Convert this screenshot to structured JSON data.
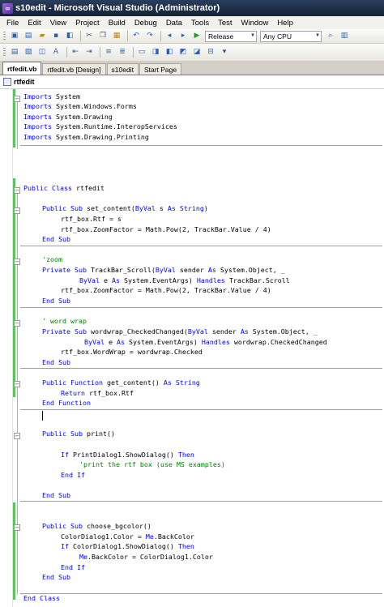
{
  "window": {
    "title": "s10edit - Microsoft Visual Studio (Administrator)"
  },
  "menu": [
    "File",
    "Edit",
    "View",
    "Project",
    "Build",
    "Debug",
    "Data",
    "Tools",
    "Test",
    "Window",
    "Help"
  ],
  "toolbar": {
    "configuration": "Release",
    "platform": "Any CPU"
  },
  "tabs": [
    "rtfedit.vb",
    "rtfedit.vb [Design]",
    "s10edit",
    "Start Page"
  ],
  "editor": {
    "class_selector": "rtfedit",
    "code_lines": [
      "Imports System",
      "Imports System.Windows.Forms",
      "Imports System.Drawing",
      "Imports System.Runtime.InteropServices",
      "Imports System.Drawing.Printing",
      "Public Class rtfedit",
      "Public Sub set_content(ByVal s As String)",
      "rtf_box.Rtf = s",
      "rtf_box.ZoomFactor = Math.Pow(2, TrackBar.Value / 4)",
      "End Sub",
      "'zoom",
      "Private Sub TrackBar_Scroll(ByVal sender As System.Object, _",
      "ByVal e As System.EventArgs) Handles TrackBar.Scroll",
      "rtf_box.ZoomFactor = Math.Pow(2, TrackBar.Value / 4)",
      "End Sub",
      "' word wrap",
      "Private Sub wordwrap_CheckedChanged(ByVal sender As System.Object, _",
      "ByVal e As System.EventArgs) Handles wordwrap.CheckedChanged",
      "rtf_box.WordWrap = wordwrap.Checked",
      "End Sub",
      "Public Function get_content() As String",
      "Return rtf_box.Rtf",
      "End Function",
      "Public Sub print()",
      "If PrintDialog1.ShowDialog() Then",
      "'print the rtf box (use MS examples)",
      "End If",
      "End Sub",
      "Public Sub choose_bgcolor()",
      "ColorDialog1.Color = Me.BackColor",
      "If ColorDialog1.ShowDialog() Then",
      "Me.BackColor = ColorDialog1.Color",
      "End If",
      "End Sub",
      "End Class"
    ]
  },
  "colors": {
    "keyword": "#0000ff",
    "comment": "#008000",
    "type": "#2b91af",
    "change_bar": "#5cc45c"
  }
}
